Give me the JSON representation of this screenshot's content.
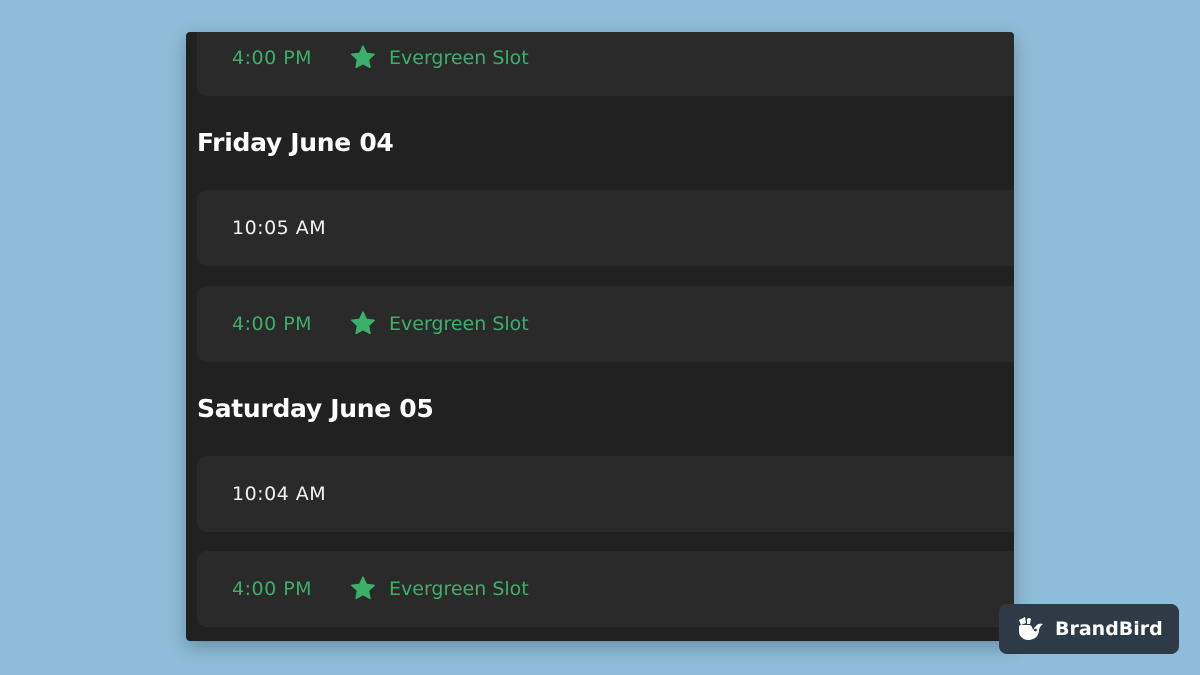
{
  "colors": {
    "background": "#8dbdd8",
    "panel": "#212121",
    "slot": "#2a2a2a",
    "accent_green": "#3bb06a",
    "badge": "#2f3a47"
  },
  "schedule": {
    "top_slot": {
      "time": "4:00 PM",
      "tag": "Evergreen Slot",
      "icon": "star-icon"
    },
    "days": [
      {
        "heading": "Friday June 04",
        "slots": [
          {
            "time": "10:05 AM"
          },
          {
            "time": "4:00 PM",
            "tag": "Evergreen Slot",
            "icon": "star-icon"
          }
        ]
      },
      {
        "heading": "Saturday June 05",
        "slots": [
          {
            "time": "10:04 AM"
          },
          {
            "time": "4:00 PM",
            "tag": "Evergreen Slot",
            "icon": "star-icon"
          }
        ]
      }
    ]
  },
  "watermark": {
    "name": "BrandBird",
    "icon": "brandbird-logo-icon"
  }
}
